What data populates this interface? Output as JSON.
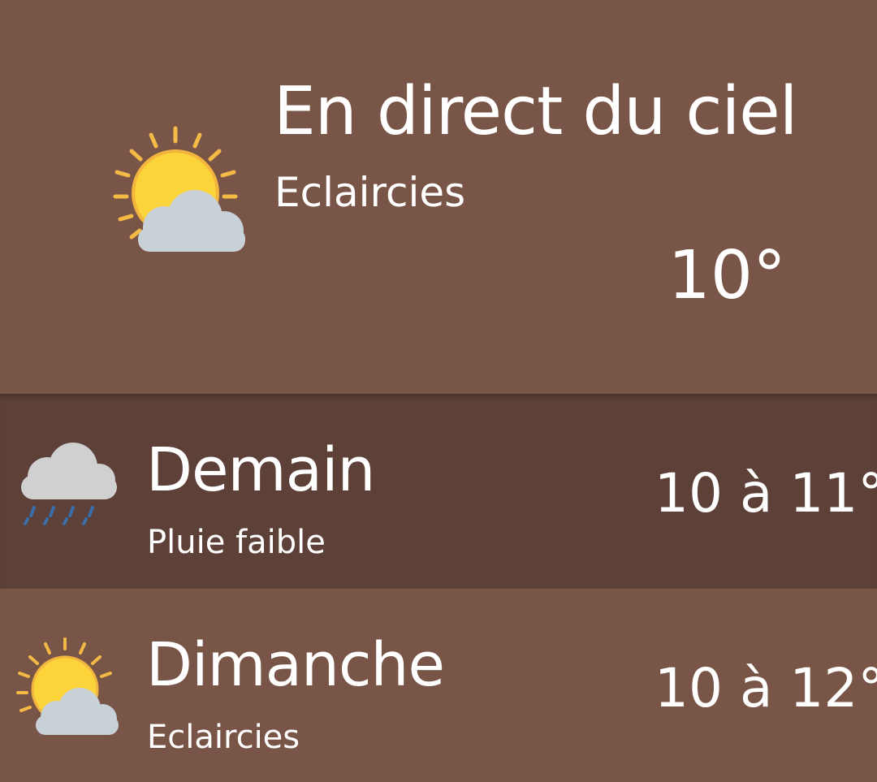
{
  "current": {
    "title": "En direct du ciel",
    "condition": "Eclaircies",
    "temperature": "10°",
    "icon": "sun-behind-cloud-icon"
  },
  "forecast": [
    {
      "day": "Demain",
      "condition": "Pluie faible",
      "range": "10 à 11°",
      "icon": "rain-cloud-icon"
    },
    {
      "day": "Dimanche",
      "condition": "Eclaircies",
      "range": "10 à 12°",
      "icon": "sun-behind-cloud-icon"
    }
  ],
  "colors": {
    "background": "#795548",
    "highlight_row": "#5d4037",
    "sun": "#fbd33a",
    "sun_rays": "#f5b945",
    "cloud": "#c8d0d8",
    "rain_cloud": "#d0d0d0",
    "rain_drops": "#3b6ea8"
  }
}
